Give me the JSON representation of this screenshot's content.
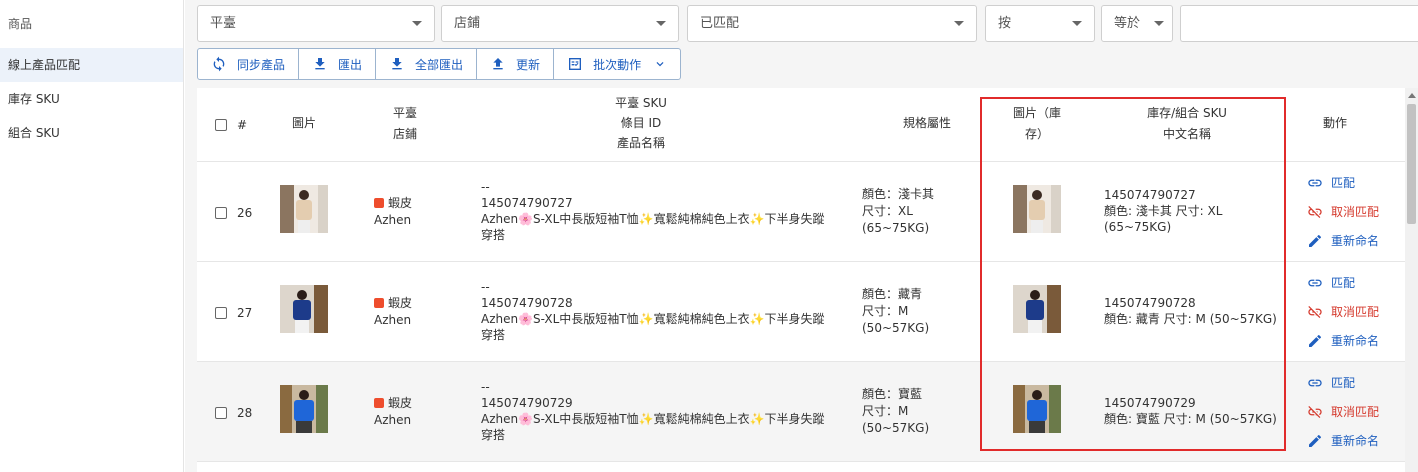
{
  "sidebar": {
    "header": "商品",
    "items": [
      {
        "label": "線上產品匹配"
      },
      {
        "label": "庫存 SKU"
      },
      {
        "label": "組合 SKU"
      }
    ]
  },
  "filters": {
    "platform": "平臺",
    "shop": "店鋪",
    "match_status": "已匹配",
    "by": "按",
    "operator": "等於"
  },
  "toolbar": {
    "sync": "同步產品",
    "export": "匯出",
    "export_all": "全部匯出",
    "update": "更新",
    "batch": "批次動作"
  },
  "table": {
    "headers": {
      "index": "#",
      "image": "圖片",
      "platform": "平臺",
      "shop": "店鋪",
      "platform_sku": "平臺 SKU",
      "item_id": "條目 ID",
      "product_name": "產品名稱",
      "spec": "規格屬性",
      "inv_image_1": "圖片（庫",
      "inv_image_2": "存）",
      "inv_sku": "庫存/組合 SKU",
      "cn_name": "中文名稱",
      "action": "動作"
    },
    "rows": [
      {
        "num": "26",
        "platform": "蝦皮",
        "shop": "Azhen",
        "sku": "--",
        "item_id": "145074790727",
        "name_1": "Azhen🌸S-XL中長版短袖T恤✨寬鬆純棉純色上衣✨下半身失蹤",
        "name_2": "穿搭",
        "color": "顏色：淺卡其",
        "size": "尺寸：XL",
        "weight": "(65~75KG)",
        "inv_sku": "145074790727",
        "inv_name_1": "顏色: 淺卡其 尺寸: XL",
        "inv_name_2": "(65~75KG)"
      },
      {
        "num": "27",
        "platform": "蝦皮",
        "shop": "Azhen",
        "sku": "--",
        "item_id": "145074790728",
        "name_1": "Azhen🌸S-XL中長版短袖T恤✨寬鬆純棉純色上衣✨下半身失蹤",
        "name_2": "穿搭",
        "color": "顏色：藏青",
        "size": "尺寸：M",
        "weight": "(50~57KG)",
        "inv_sku": "145074790728",
        "inv_name_1": "顏色: 藏青 尺寸: M (50~57KG)",
        "inv_name_2": ""
      },
      {
        "num": "28",
        "platform": "蝦皮",
        "shop": "Azhen",
        "sku": "--",
        "item_id": "145074790729",
        "name_1": "Azhen🌸S-XL中長版短袖T恤✨寬鬆純棉純色上衣✨下半身失蹤",
        "name_2": "穿搭",
        "color": "顏色：寶藍",
        "size": "尺寸：M",
        "weight": "(50~57KG)",
        "inv_sku": "145074790729",
        "inv_name_1": "顏色: 寶藍 尺寸: M (50~57KG)",
        "inv_name_2": ""
      }
    ],
    "actions": {
      "match": "匹配",
      "unmatch": "取消匹配",
      "rename": "重新命名"
    }
  },
  "colors": {
    "accent": "#1f5fbf",
    "danger": "#d53a2e",
    "highlight": "#e12b2b",
    "shopee": "#ee4d2d"
  }
}
